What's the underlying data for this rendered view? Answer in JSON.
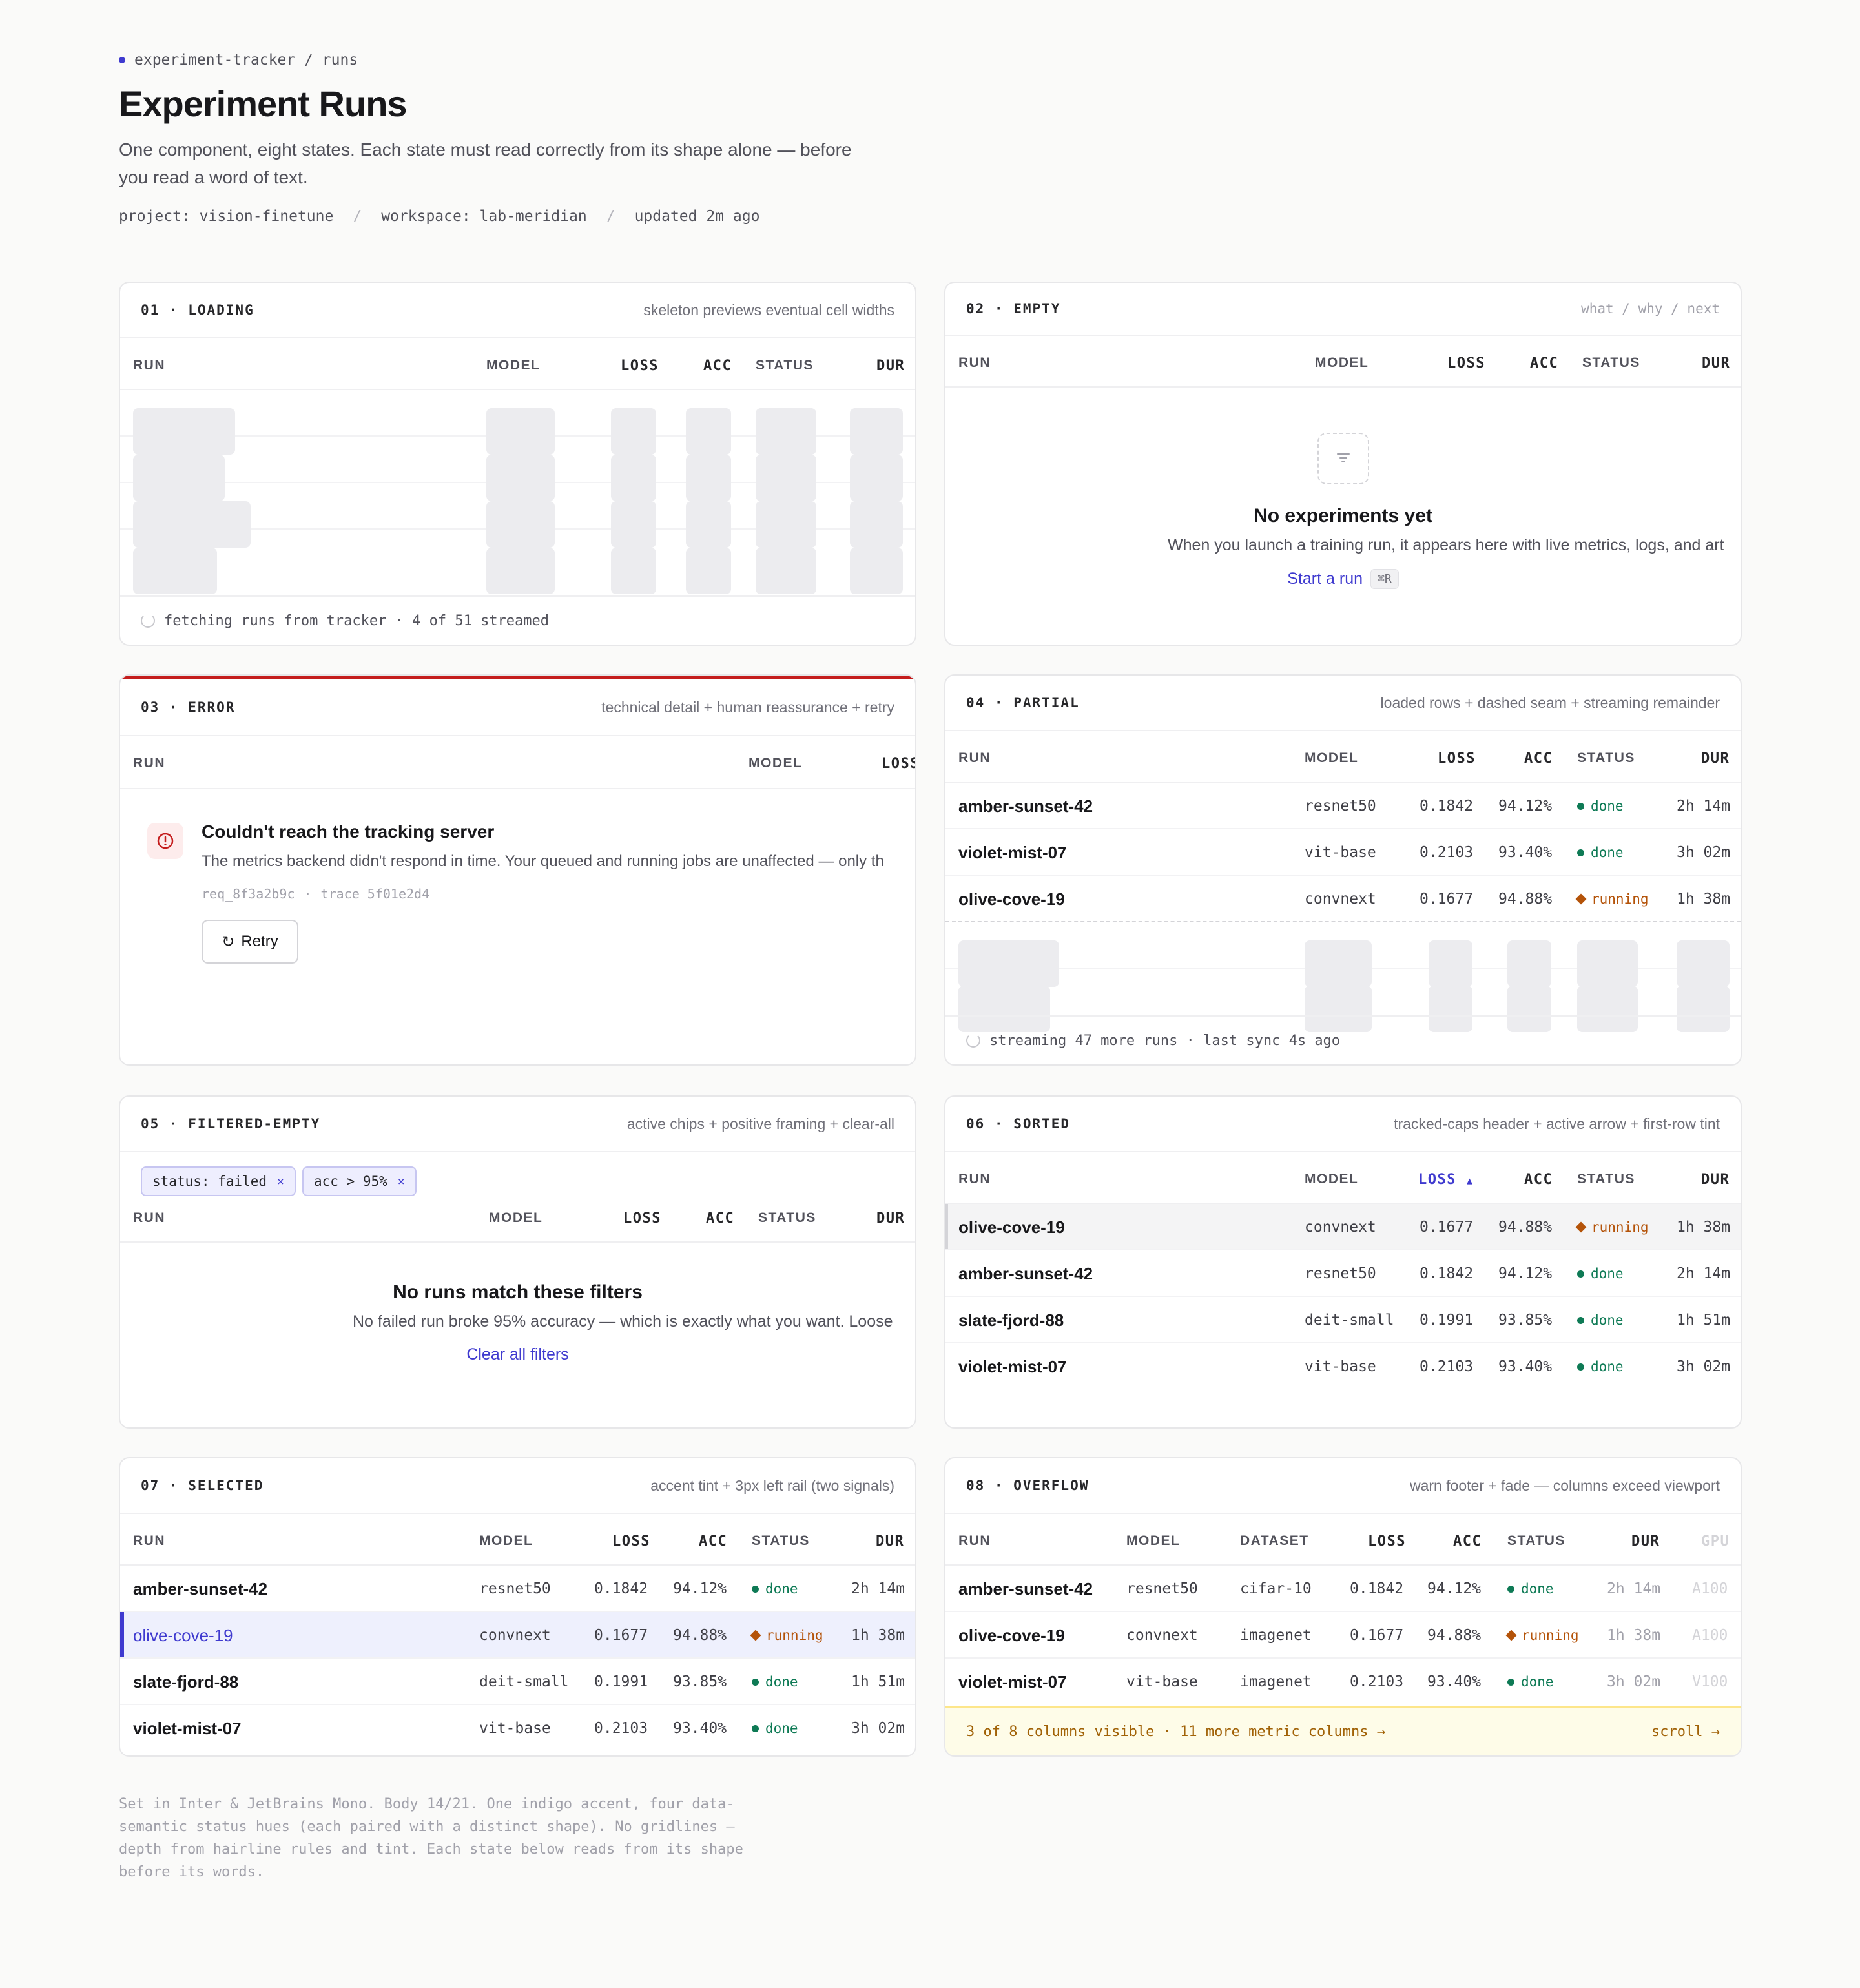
{
  "header": {
    "breadcrumb": "experiment-tracker / runs",
    "title": "Experiment Runs",
    "subtitle": "One component, eight states. Each state must read correctly from its shape alone — before you read a word of text.",
    "meta": {
      "project": "project: vision-finetune",
      "sep": "/",
      "workspace": "workspace: lab-meridian",
      "updated": "updated 2m ago"
    }
  },
  "columns": {
    "run": "RUN",
    "model": "MODEL",
    "loss": "LOSS",
    "acc": "ACC",
    "status": "STATUS",
    "dur": "DUR",
    "dataset": "DATASET",
    "gpu": "GPU"
  },
  "loading": {
    "tag": "01 · LOADING",
    "note": "skeleton previews eventual cell widths",
    "footer": "fetching runs from tracker · 4 of 51 streamed"
  },
  "empty": {
    "tag": "02 · EMPTY",
    "note": "what / why / next",
    "title": "No experiments yet",
    "text": "When you launch a training run, it appears here with live metrics, logs, and art",
    "cta": "Start a run",
    "shortcut": "⌘R"
  },
  "error": {
    "tag": "03 · ERROR",
    "note": "technical detail + human reassurance + retry",
    "title": "Couldn't reach the tracking server",
    "text": "The metrics backend didn't respond in time. Your queued and running jobs are unaffected — only th",
    "request_id": "req_8f3a2b9c",
    "trace": "trace 5f01e2d4",
    "retry": "Retry",
    "colors": {
      "accent": "#c41d1d"
    }
  },
  "partial": {
    "tag": "04 · PARTIAL",
    "note": "loaded rows + dashed seam + streaming remainder",
    "rows": [
      {
        "run": "amber-sunset-42",
        "model": "resnet50",
        "loss": "0.1842",
        "acc": "94.12%",
        "status": "done",
        "dur": "2h 14m"
      },
      {
        "run": "violet-mist-07",
        "model": "vit-base",
        "loss": "0.2103",
        "acc": "93.40%",
        "status": "done",
        "dur": "3h 02m"
      },
      {
        "run": "olive-cove-19",
        "model": "convnext",
        "loss": "0.1677",
        "acc": "94.88%",
        "status": "running",
        "dur": "1h 38m"
      }
    ],
    "footer": "streaming 47 more runs · last sync 4s ago"
  },
  "filtered": {
    "tag": "05 · FILTERED-EMPTY",
    "note": "active chips + positive framing + clear-all",
    "chips": [
      "status: failed",
      "acc > 95%"
    ],
    "chip_close": "×",
    "title": "No runs match these filters",
    "text": "No failed run broke 95% accuracy — which is exactly what you want. Loose",
    "cta": "Clear all filters"
  },
  "sorted": {
    "tag": "06 · SORTED",
    "note": "tracked-caps header + active arrow + first-row tint",
    "arrow": "▲",
    "rows": [
      {
        "run": "olive-cove-19",
        "model": "convnext",
        "loss": "0.1677",
        "acc": "94.88%",
        "status": "running",
        "dur": "1h 38m"
      },
      {
        "run": "amber-sunset-42",
        "model": "resnet50",
        "loss": "0.1842",
        "acc": "94.12%",
        "status": "done",
        "dur": "2h 14m"
      },
      {
        "run": "slate-fjord-88",
        "model": "deit-small",
        "loss": "0.1991",
        "acc": "93.85%",
        "status": "done",
        "dur": "1h 51m"
      },
      {
        "run": "violet-mist-07",
        "model": "vit-base",
        "loss": "0.2103",
        "acc": "93.40%",
        "status": "done",
        "dur": "3h 02m"
      }
    ]
  },
  "selected": {
    "tag": "07 · SELECTED",
    "note": "accent tint + 3px left rail (two signals)",
    "rows": [
      {
        "run": "amber-sunset-42",
        "model": "resnet50",
        "loss": "0.1842",
        "acc": "94.12%",
        "status": "done",
        "dur": "2h 14m"
      },
      {
        "run": "olive-cove-19",
        "model": "convnext",
        "loss": "0.1677",
        "acc": "94.88%",
        "status": "running",
        "dur": "1h 38m"
      },
      {
        "run": "slate-fjord-88",
        "model": "deit-small",
        "loss": "0.1991",
        "acc": "93.85%",
        "status": "done",
        "dur": "1h 51m"
      },
      {
        "run": "violet-mist-07",
        "model": "vit-base",
        "loss": "0.2103",
        "acc": "93.40%",
        "status": "done",
        "dur": "3h 02m"
      }
    ]
  },
  "overflow": {
    "tag": "08 · OVERFLOW",
    "note": "warn footer + fade — columns exceed viewport",
    "rows": [
      {
        "run": "amber-sunset-42",
        "model": "resnet50",
        "dataset": "cifar-10",
        "loss": "0.1842",
        "acc": "94.12%",
        "status": "done",
        "dur": "2h 14m",
        "gpu": "A100"
      },
      {
        "run": "olive-cove-19",
        "model": "convnext",
        "dataset": "imagenet",
        "loss": "0.1677",
        "acc": "94.88%",
        "status": "running",
        "dur": "1h 38m",
        "gpu": "A100"
      },
      {
        "run": "violet-mist-07",
        "model": "vit-base",
        "dataset": "imagenet",
        "loss": "0.2103",
        "acc": "93.40%",
        "status": "done",
        "dur": "3h 02m",
        "gpu": "V100"
      }
    ],
    "footer": "3 of 8 columns visible · 11 more metric columns →",
    "scroll": "scroll →"
  },
  "colophon": "Set in Inter & JetBrains Mono. Body 14/21. One indigo accent, four data-semantic status hues (each paired with a distinct shape). No gridlines — depth from hairline rules and tint. Each state below reads from its shape before its words.",
  "colors": {
    "accent": "#3f3acf",
    "done": "#0e7a55",
    "running": "#b45309",
    "error": "#c41d1d",
    "warn_bg": "#fefce8"
  }
}
